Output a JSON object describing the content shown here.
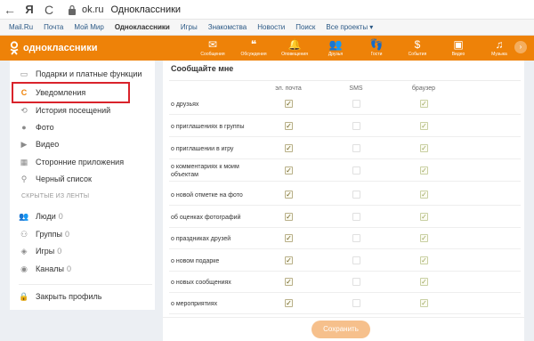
{
  "browser": {
    "back_icon": "←",
    "yandex_icon": "Я",
    "reload_icon": "C",
    "domain": "ok.ru",
    "page_title": "Одноклассники"
  },
  "service_bar": {
    "items": [
      "Mail.Ru",
      "Почта",
      "Мой Мир",
      "Одноклассники",
      "Игры",
      "Знакомства",
      "Новости",
      "Поиск"
    ],
    "more": "Все проекты ▾"
  },
  "header": {
    "logo_text": "одноклассники",
    "nav": [
      {
        "label": "Сообщения",
        "icon": "✉"
      },
      {
        "label": "Обсуждения",
        "icon": "❝"
      },
      {
        "label": "Оповещения",
        "icon": "🔔"
      },
      {
        "label": "Друзья",
        "icon": "👥"
      },
      {
        "label": "Гости",
        "icon": "👣"
      },
      {
        "label": "События",
        "icon": "$"
      },
      {
        "label": "Видео",
        "icon": "▣"
      },
      {
        "label": "Музыка",
        "icon": "♫"
      }
    ],
    "arrow_icon": "›",
    "accent": "#ee8208"
  },
  "sidebar": {
    "items": [
      {
        "label": "Подарки и платные функции",
        "icon": "▭"
      },
      {
        "label": "Уведомления",
        "icon": "C"
      },
      {
        "label": "История посещений",
        "icon": "⟲"
      },
      {
        "label": "Фото",
        "icon": "●"
      },
      {
        "label": "Видео",
        "icon": "▶"
      },
      {
        "label": "Сторонние приложения",
        "icon": "▦"
      },
      {
        "label": "Черный список",
        "icon": "⚲"
      }
    ],
    "hidden_section": "СКРЫТЫЕ ИЗ ЛЕНТЫ",
    "hidden": [
      {
        "label": "Люди",
        "count": "0",
        "icon": "👥"
      },
      {
        "label": "Группы",
        "count": "0",
        "icon": "⚇"
      },
      {
        "label": "Игры",
        "count": "0",
        "icon": "◈"
      },
      {
        "label": "Каналы",
        "count": "0",
        "icon": "◉"
      }
    ],
    "close_profile": {
      "label": "Закрыть профиль",
      "icon": "🔒"
    }
  },
  "main": {
    "title": "Сообщайте мне",
    "columns": [
      "эл. почта",
      "SMS",
      "браузер"
    ],
    "rows": [
      {
        "label": "о друзьях",
        "email": true,
        "sms": false,
        "browser": true
      },
      {
        "label": "о приглашениях в группы",
        "email": true,
        "sms": false,
        "browser": true
      },
      {
        "label": "о приглашении в игру",
        "email": true,
        "sms": false,
        "browser": true
      },
      {
        "label": "о комментариях к моим объектам",
        "email": true,
        "sms": false,
        "browser": true
      },
      {
        "label": "о новой отметке на фото",
        "email": true,
        "sms": false,
        "browser": true
      },
      {
        "label": "об оценках фотографий",
        "email": true,
        "sms": false,
        "browser": true
      },
      {
        "label": "о праздниках друзей",
        "email": true,
        "sms": false,
        "browser": true
      },
      {
        "label": "о новом подарке",
        "email": true,
        "sms": false,
        "browser": true
      },
      {
        "label": "о новых сообщениях",
        "email": true,
        "sms": false,
        "browser": true
      },
      {
        "label": "о мероприятиях",
        "email": true,
        "sms": false,
        "browser": true
      }
    ],
    "save_label": "Сохранить"
  }
}
